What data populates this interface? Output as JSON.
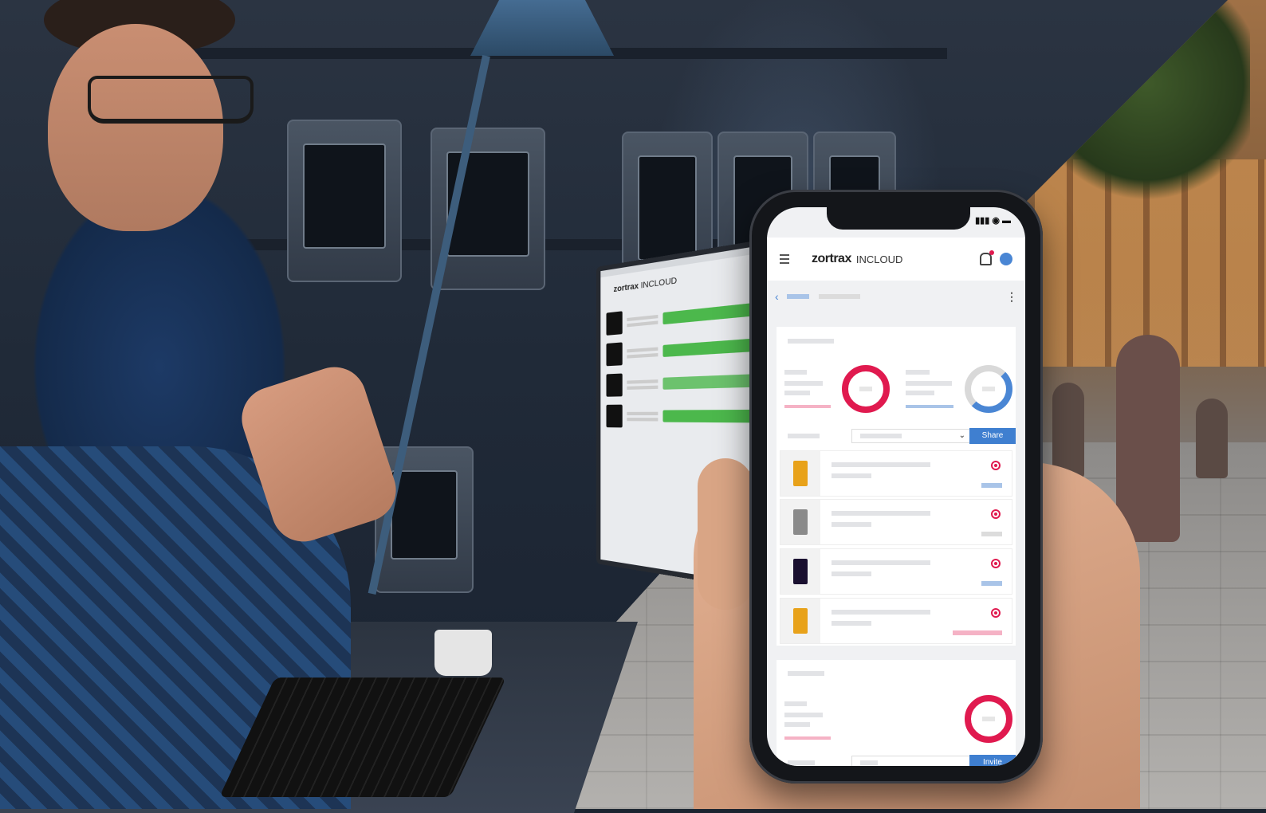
{
  "app": {
    "brand": "zortrax",
    "product": "INCLOUD"
  },
  "phone": {
    "share_label": "Share",
    "invite_label": "Invite",
    "printers": [
      {
        "thumb_color": "#e8a21a",
        "badge_color": "#a9c4e8"
      },
      {
        "thumb_color": "#8a8a8a",
        "badge_color": "#dcdcdc"
      },
      {
        "thumb_color": "#1a1030",
        "badge_color": "#a9c4e8"
      },
      {
        "thumb_color": "#e8a21a",
        "badge_color": "#f5b2c5"
      }
    ]
  },
  "monitor": {
    "brand": "zortrax",
    "product": "INCLOUD"
  },
  "colors": {
    "accent_red": "#e01a4f",
    "accent_blue": "#3f7fd0",
    "progress_green": "#4cb84c"
  }
}
